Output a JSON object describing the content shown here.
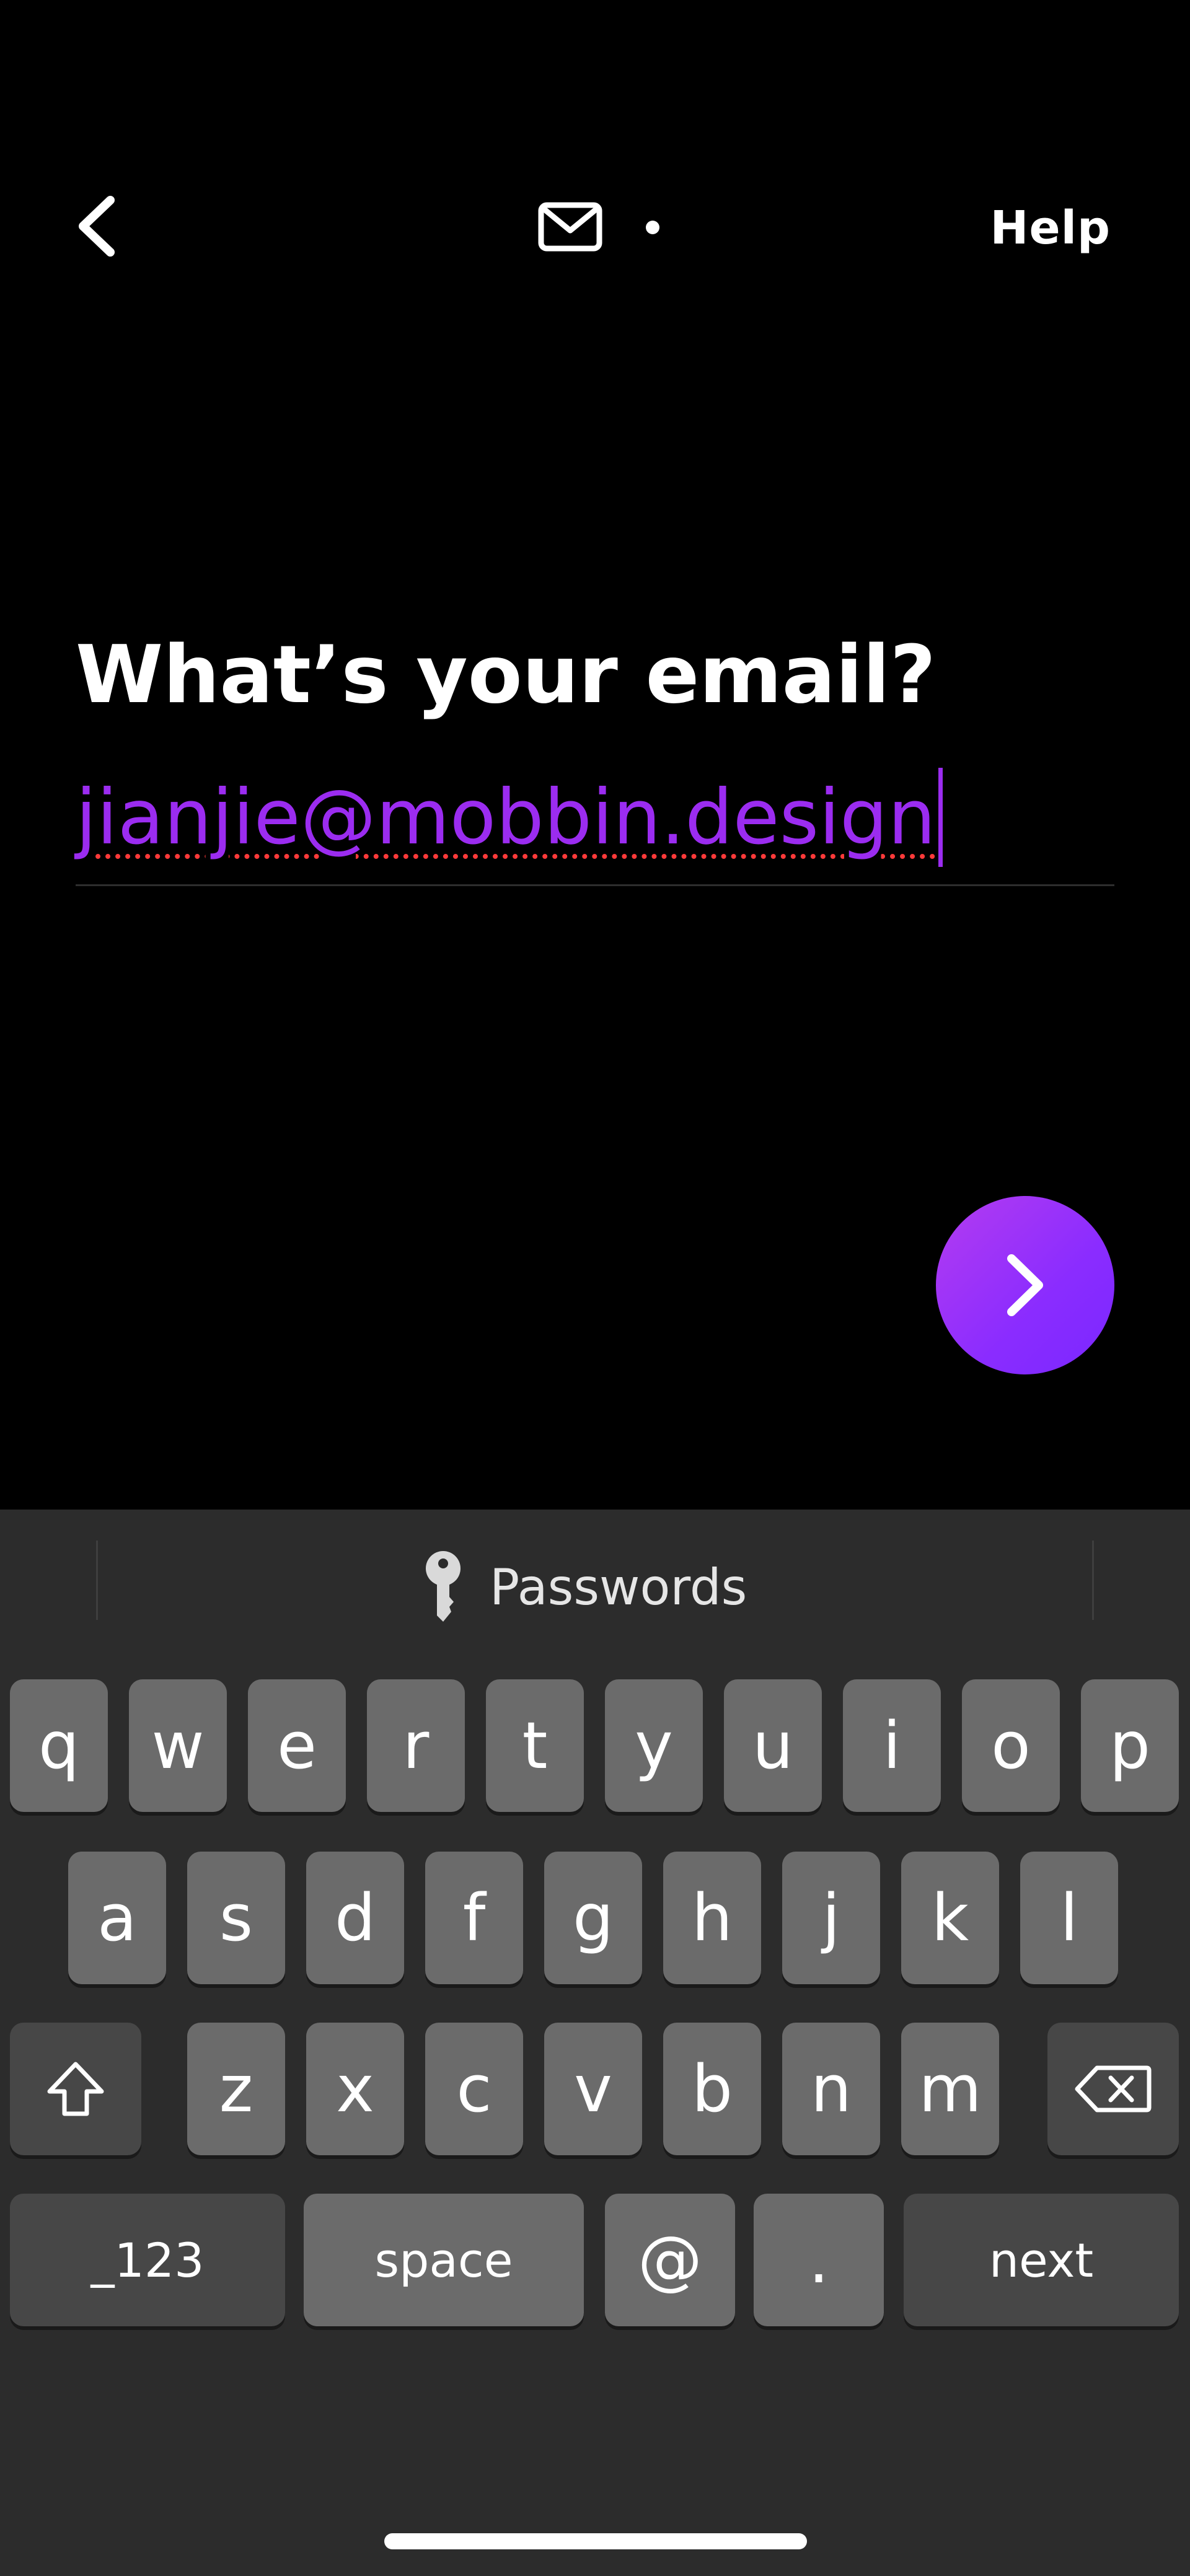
{
  "header": {
    "back_icon": "chevron-left-icon",
    "step_icon": "mail-icon",
    "help_label": "Help"
  },
  "main": {
    "title": "What’s your email?",
    "email_value": "jianjie@mobbin.design",
    "next_icon": "chevron-right-icon"
  },
  "keyboard": {
    "suggestion": {
      "icon": "key-icon",
      "label": "Passwords"
    },
    "row1": [
      "q",
      "w",
      "e",
      "r",
      "t",
      "y",
      "u",
      "i",
      "o",
      "p"
    ],
    "row2": [
      "a",
      "s",
      "d",
      "f",
      "g",
      "h",
      "j",
      "k",
      "l"
    ],
    "row3": [
      "z",
      "x",
      "c",
      "v",
      "b",
      "n",
      "m"
    ],
    "shift_icon": "shift-icon",
    "delete_icon": "delete-icon",
    "numbers_label": "_123",
    "space_label": "space",
    "at_label": "@",
    "dot_label": ".",
    "next_label": "next"
  },
  "colors": {
    "accent": "#9b2cf0",
    "background": "#000000",
    "keyboard_bg": "#2c2c2c",
    "key_bg": "#6b6b6b",
    "key_dark_bg": "#474747"
  }
}
